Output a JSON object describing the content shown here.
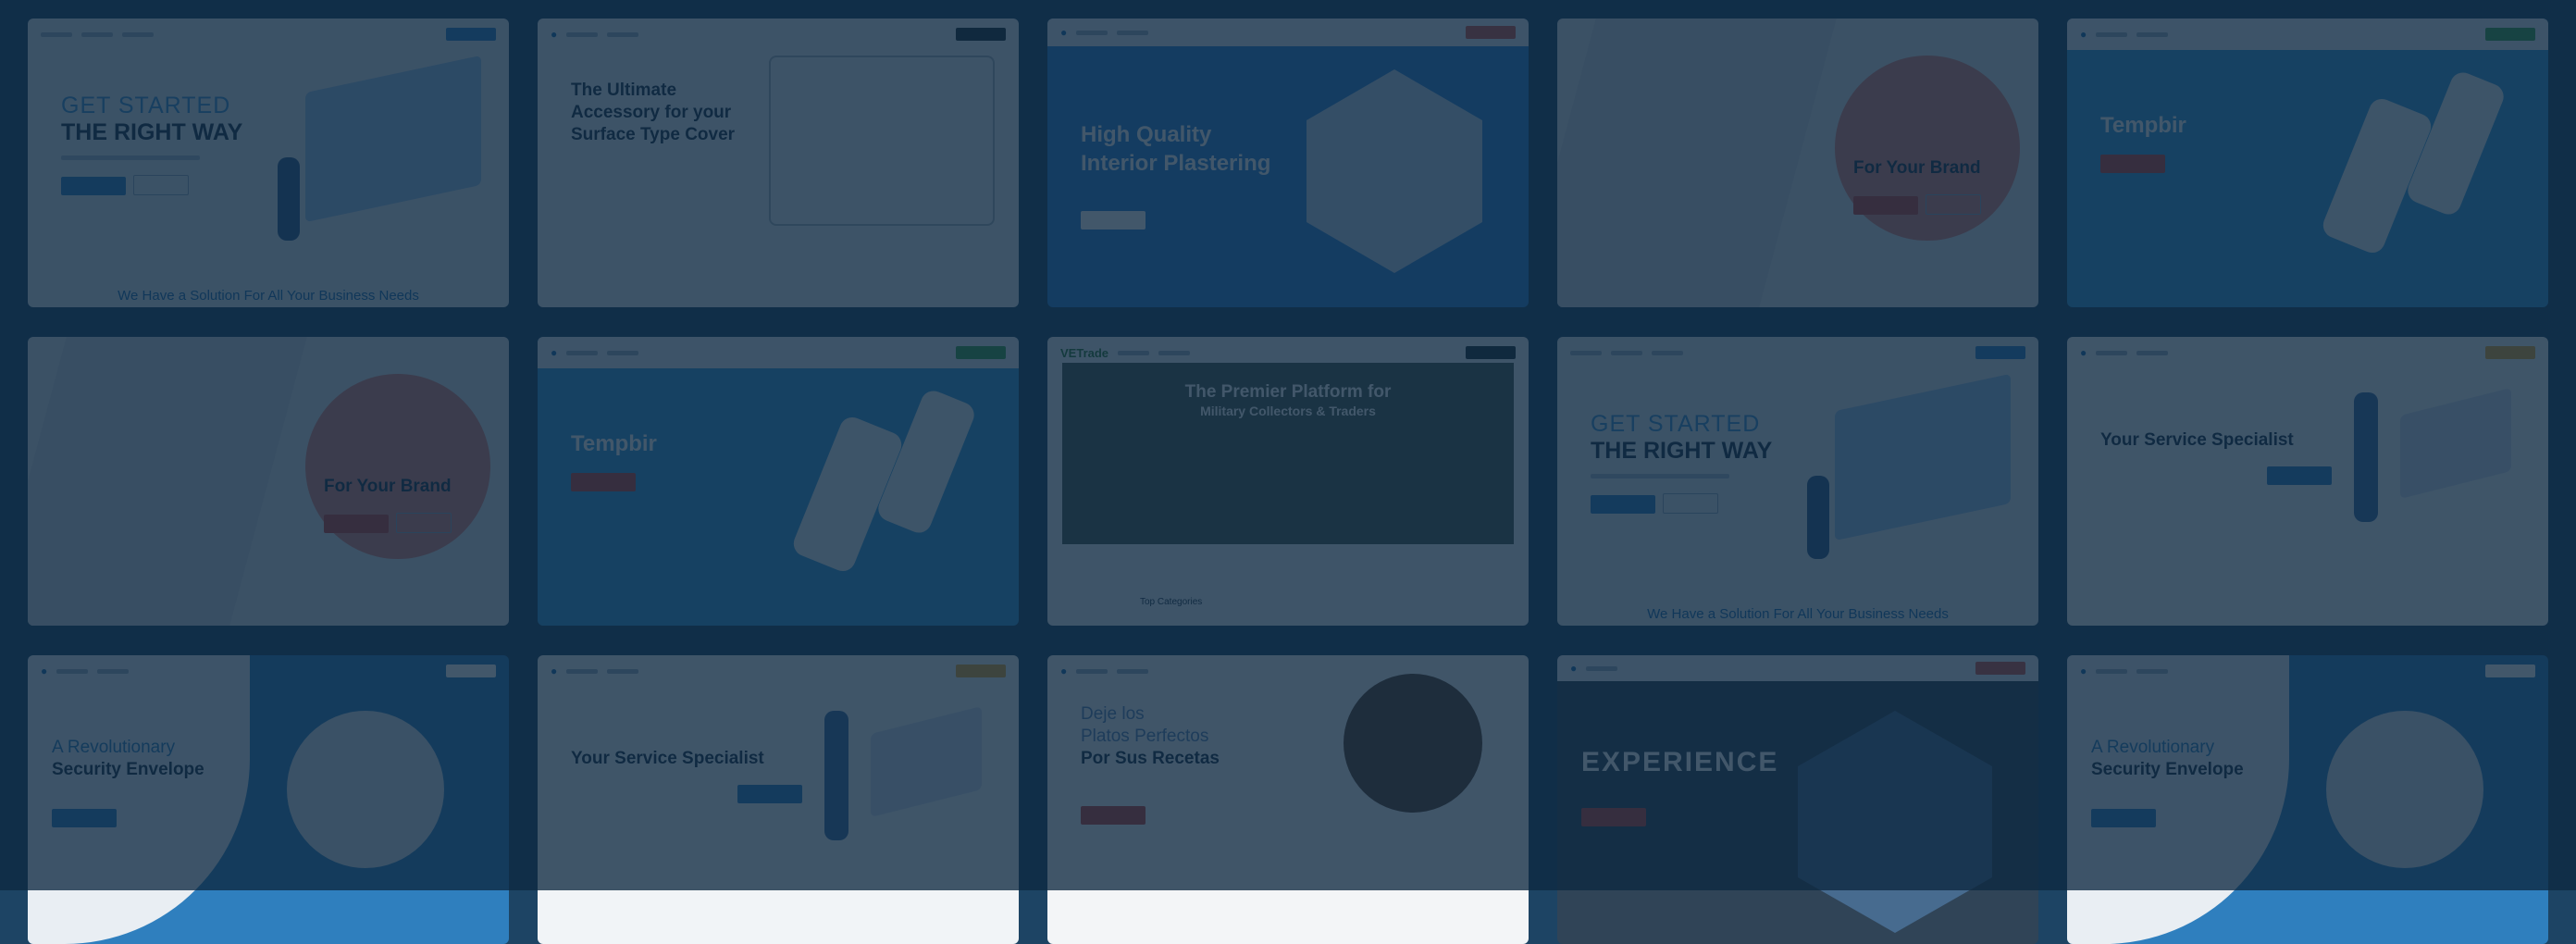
{
  "cards": [
    {
      "name": "get-started-1",
      "lines": [
        "GET STARTED",
        "THE RIGHT WAY"
      ],
      "footer": "We Have a Solution For All Your Business Needs"
    },
    {
      "name": "accessory",
      "lines": [
        "The Ultimate",
        "Accessory for your",
        "Surface Type Cover"
      ]
    },
    {
      "name": "plastering",
      "lines": [
        "High Quality",
        "Interior Plastering"
      ]
    },
    {
      "name": "for-your-brand-1",
      "lines": [
        "For Your Brand"
      ]
    },
    {
      "name": "tempbir-1",
      "lines": [
        "Tempbir"
      ]
    },
    {
      "name": "for-your-brand-2",
      "lines": [
        "For Your Brand"
      ]
    },
    {
      "name": "tempbir-2",
      "lines": [
        "Tempbir"
      ]
    },
    {
      "name": "vetrade",
      "logo": "VETrade",
      "lines": [
        "The Premier Platform for",
        "Military Collectors & Traders"
      ],
      "footer": "Top Categories"
    },
    {
      "name": "get-started-2",
      "lines": [
        "GET STARTED",
        "THE RIGHT WAY"
      ],
      "footer": "We Have a Solution For All Your Business Needs"
    },
    {
      "name": "service-specialist-1",
      "lines": [
        "Your Service Specialist"
      ]
    },
    {
      "name": "security-envelope-1",
      "lines": [
        "A Revolutionary",
        "Security Envelope"
      ]
    },
    {
      "name": "service-specialist-2",
      "lines": [
        "Your Service Specialist"
      ]
    },
    {
      "name": "recetas",
      "lines": [
        "Deje los",
        "Platos Perfectos",
        "Por Sus Recetas"
      ]
    },
    {
      "name": "experience",
      "lines": [
        "EXPERIENCE"
      ]
    },
    {
      "name": "security-envelope-2",
      "lines": [
        "A Revolutionary",
        "Security Envelope"
      ]
    }
  ]
}
